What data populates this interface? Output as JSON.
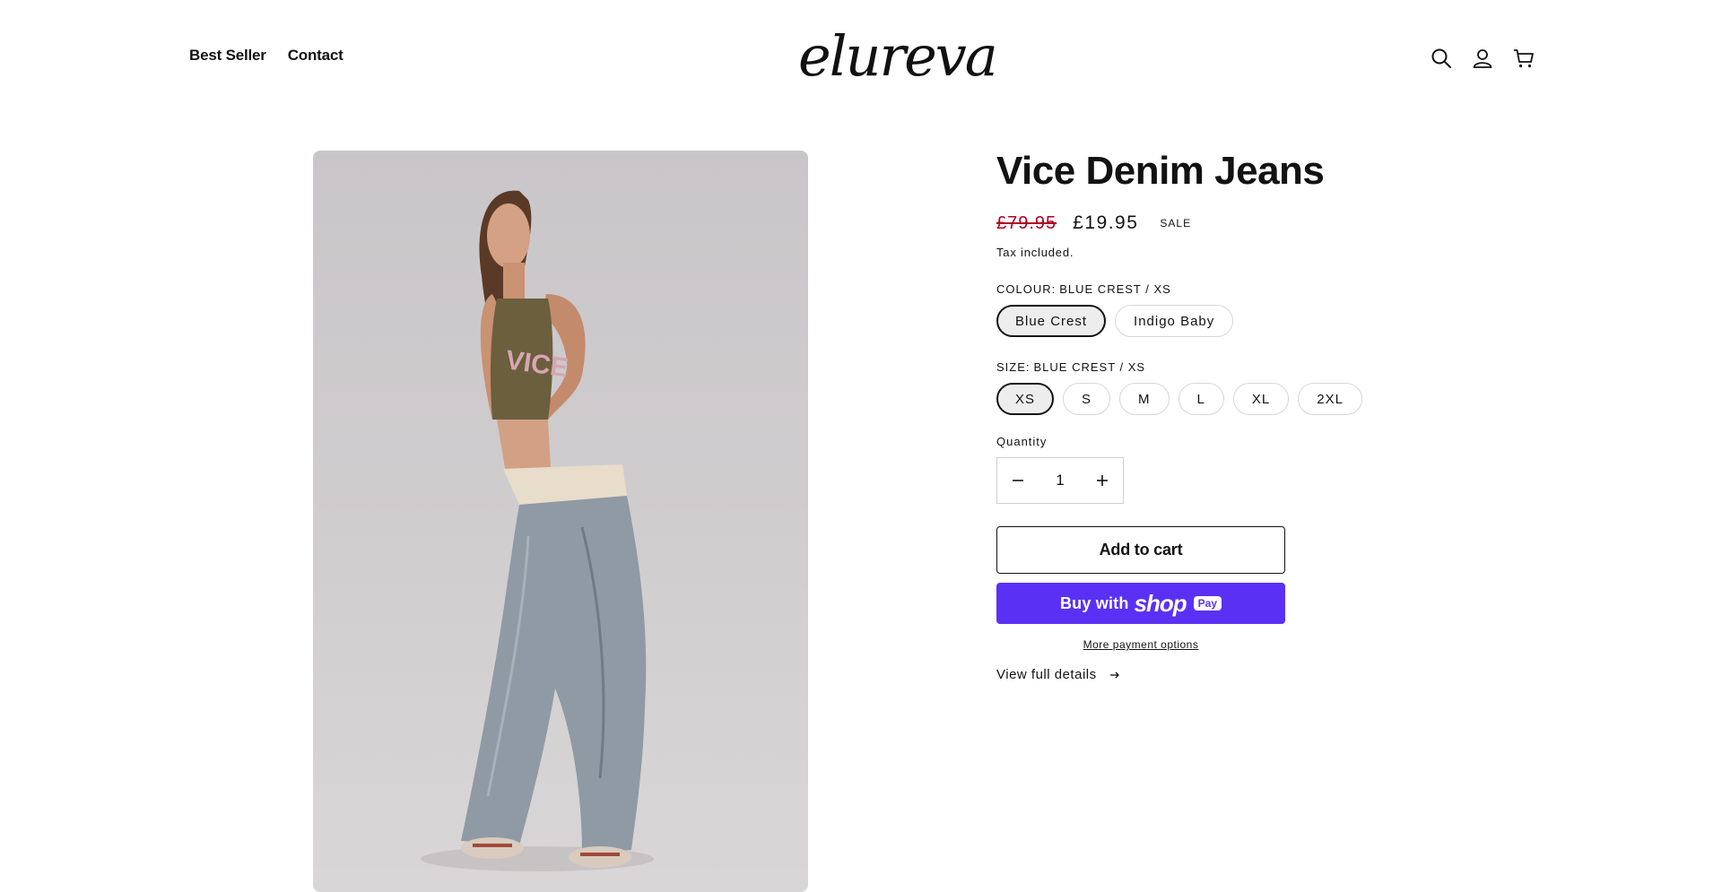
{
  "header": {
    "nav": [
      "Best Seller",
      "Contact"
    ],
    "logo": "elureva",
    "icons": [
      "search-icon",
      "account-icon",
      "cart-icon"
    ]
  },
  "product": {
    "title": "Vice Denim Jeans",
    "price_old": "£79.95",
    "price_new": "£19.95",
    "badge": "SALE",
    "tax_note": "Tax included.",
    "colour": {
      "label": "COLOUR:",
      "selected_text": "BLUE CREST / XS",
      "options": [
        "Blue Crest",
        "Indigo Baby"
      ],
      "selected_index": 0
    },
    "size": {
      "label": "SIZE:",
      "selected_text": "BLUE CREST / XS",
      "options": [
        "XS",
        "S",
        "M",
        "L",
        "XL",
        "2XL"
      ],
      "selected_index": 0
    },
    "quantity": {
      "label": "Quantity",
      "value": "1"
    },
    "add_to_cart": "Add to cart",
    "shop_pay": {
      "buy_text": "Buy with",
      "brand": "shop",
      "pay": "Pay"
    },
    "more_payment": "More payment options",
    "view_details": "View full details"
  },
  "colors": {
    "accent_shop_pay": "#5a31f4",
    "sale_price": "#b00020",
    "text": "#121212"
  }
}
